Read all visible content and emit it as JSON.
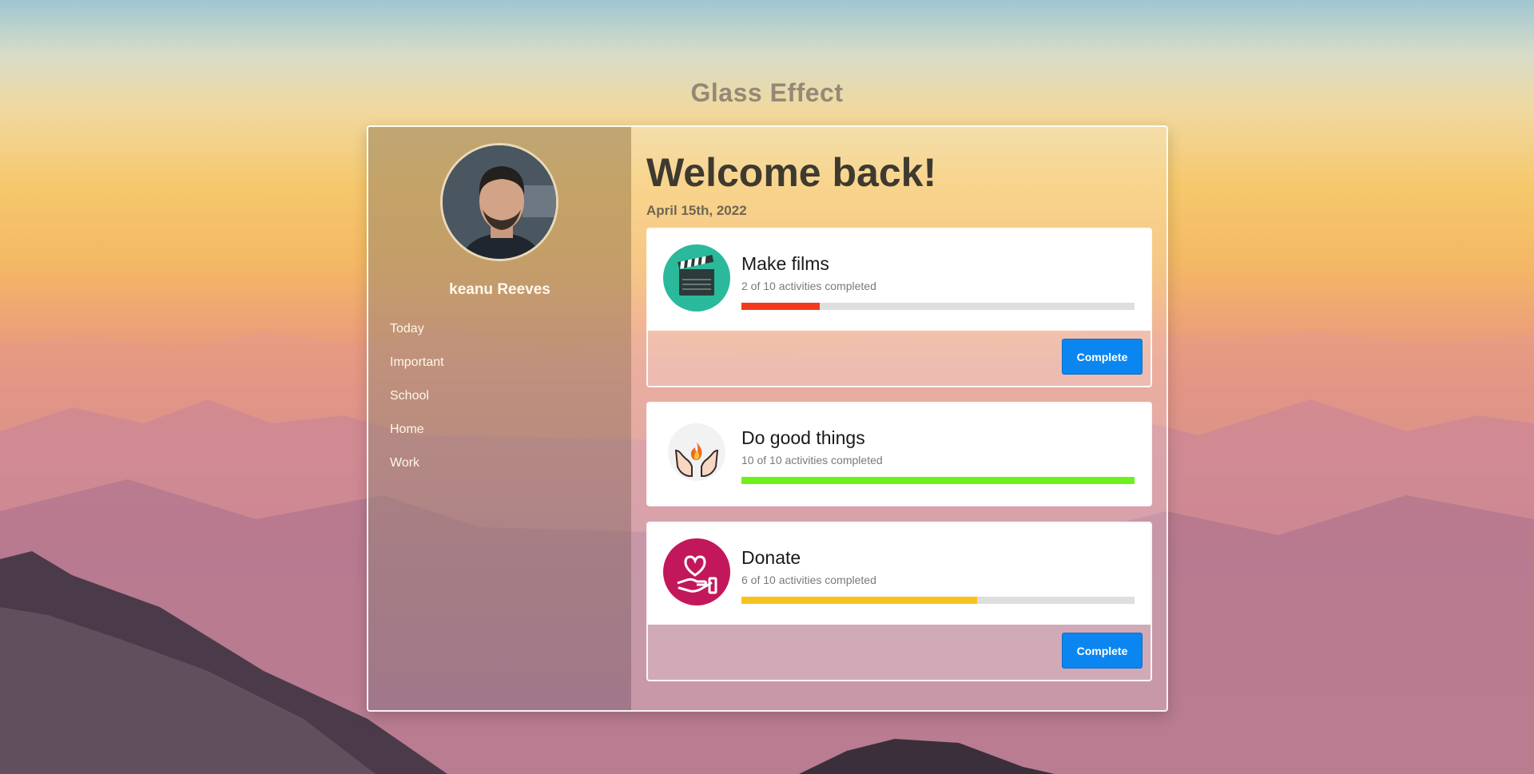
{
  "page": {
    "title": "Glass Effect"
  },
  "profile": {
    "name": "keanu Reeves"
  },
  "nav": {
    "items": [
      {
        "label": "Today"
      },
      {
        "label": "Important"
      },
      {
        "label": "School"
      },
      {
        "label": "Home"
      },
      {
        "label": "Work"
      }
    ]
  },
  "main": {
    "heading": "Welcome back!",
    "date": "April 15th, 2022"
  },
  "tasks": [
    {
      "title": "Make films",
      "subtitle": "2 of 10 activities completed",
      "progress": 0.2,
      "bar_color": "#f3391b",
      "icon": "clapperboard-icon",
      "icon_bg": "#2ab99b",
      "button_label": "Complete"
    },
    {
      "title": "Do good things",
      "subtitle": "10 of 10 activities completed",
      "progress": 1.0,
      "bar_color": "#6cf21a",
      "icon": "hands-flame-icon",
      "icon_bg": "#ffffff"
    },
    {
      "title": "Donate",
      "subtitle": "6 of 10 activities completed",
      "progress": 0.6,
      "bar_color": "#f8c21e",
      "icon": "heart-hand-icon",
      "icon_bg": "#c2185b",
      "button_label": "Complete"
    }
  ],
  "colors": {
    "accent": "#0b86f1"
  }
}
